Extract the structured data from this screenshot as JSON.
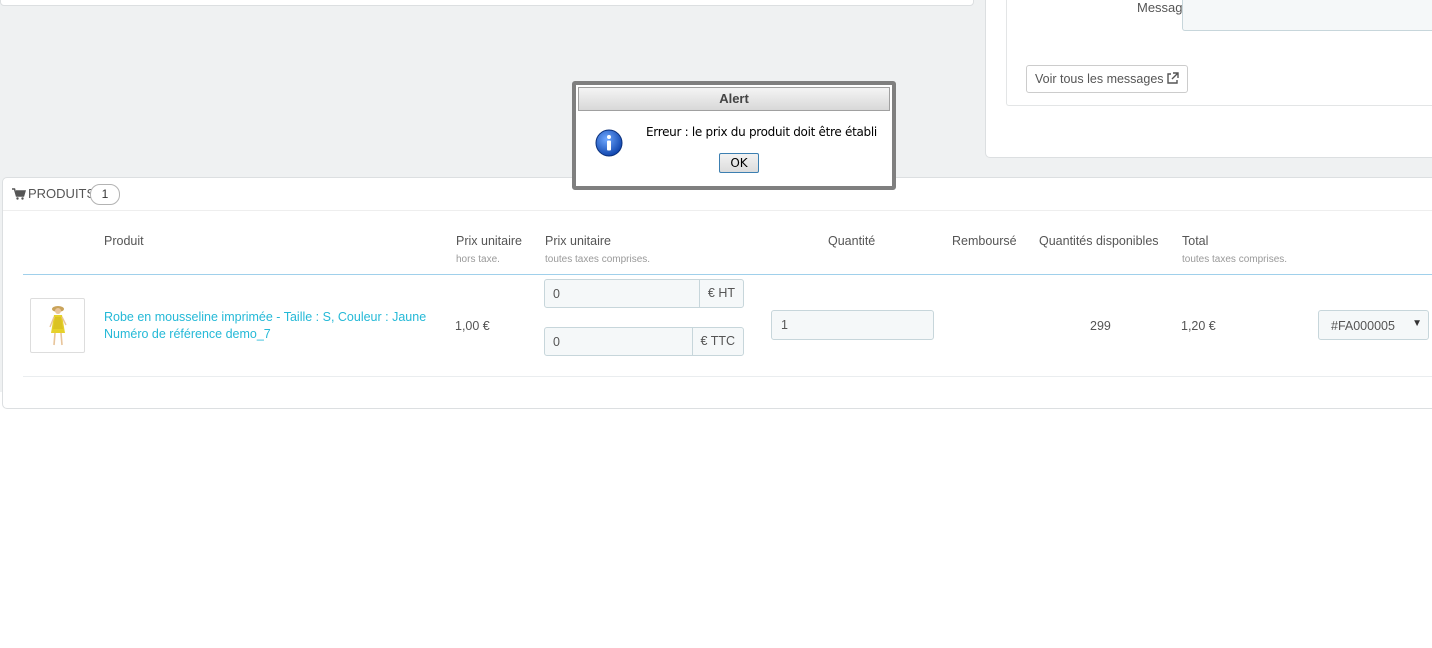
{
  "messages": {
    "message_label": "Message",
    "view_all_button": "Voir tous les messages"
  },
  "products_panel": {
    "title": "PRODUITS",
    "count": "1",
    "columns": {
      "product": "Produit",
      "unit_price_ht": "Prix unitaire",
      "unit_price_ht_sub": "hors taxe.",
      "unit_price_ttc": "Prix unitaire",
      "unit_price_ttc_sub": "toutes taxes comprises.",
      "quantity": "Quantité",
      "refunded": "Remboursé",
      "available_qty": "Quantités disponibles",
      "total": "Total",
      "total_sub": "toutes taxes comprises."
    },
    "row": {
      "name": "Robe en mousseline imprimée - Taille : S, Couleur : Jaune",
      "reference": "Numéro de référence demo_7",
      "unit_price": "1,00 €",
      "price_ht_value": "0",
      "price_ht_addon": "€ HT",
      "price_ttc_value": "0",
      "price_ttc_addon": "€ TTC",
      "quantity_value": "1",
      "available_qty": "299",
      "total": "1,20 €",
      "invoice": "#FA000005"
    }
  },
  "alert": {
    "title": "Alert",
    "message": "Erreur : le prix du produit doit être établi",
    "ok_label": "OK"
  }
}
